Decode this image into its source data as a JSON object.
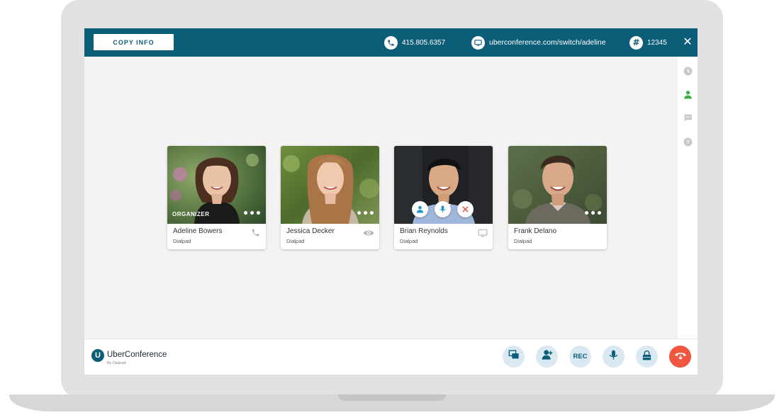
{
  "topbar": {
    "copy_info_label": "COPY INFO",
    "phone_number": "415.805.6357",
    "conference_url": "uberconference.com/switch/adeline",
    "pin_symbol": "#",
    "pin": "12345",
    "close_symbol": "✕",
    "icons": [
      "phone-icon",
      "screen-icon",
      "hash-icon",
      "close-icon"
    ]
  },
  "side_rail": {
    "icons": [
      "clock-icon",
      "person-icon",
      "chat-icon",
      "help-icon"
    ],
    "active_icon": "person-icon",
    "active_color": "#3fae49"
  },
  "participants": [
    {
      "name": "Adeline Bowers",
      "org": "Dialpad",
      "badge": "ORGANIZER",
      "status_icon": "phone-icon",
      "more": "•••"
    },
    {
      "name": "Jessica Decker",
      "org": "Dialpad",
      "status_icon": "eye-icon",
      "more": "•••"
    },
    {
      "name": "Brian Reynolds",
      "org": "Dialpad",
      "status_icon": "monitor-icon",
      "hover_actions": [
        "person-icon",
        "mic-icon",
        "close-icon"
      ]
    },
    {
      "name": "Frank Delano",
      "org": "Dialpad",
      "more": "•••"
    }
  ],
  "bottombar": {
    "logo_mark": "U",
    "logo_name": "UberConference",
    "logo_sub": "By Dialpad",
    "controls": [
      "screen-share-icon",
      "add-person-icon",
      "REC",
      "mic-icon",
      "lock-icon",
      "hangup-icon"
    ],
    "rec_label": "REC"
  },
  "colors": {
    "brand": "#0c5d78",
    "control_bg": "#d9e8f1",
    "hangup": "#f0553f",
    "active_rail": "#3fae49"
  }
}
